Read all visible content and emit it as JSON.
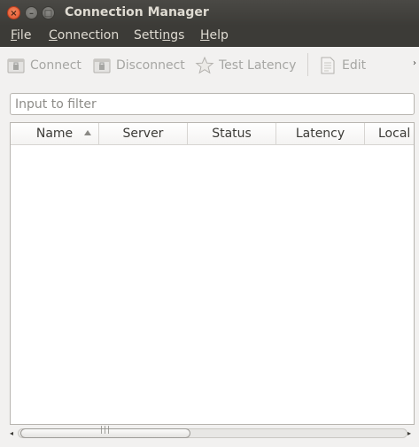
{
  "window": {
    "title": "Connection Manager",
    "close_glyph": "×",
    "minimize_glyph": "–",
    "maximize_glyph": "□"
  },
  "menu": {
    "file": {
      "mnemonic": "F",
      "rest": "ile"
    },
    "connection": {
      "mnemonic": "C",
      "rest": "onnection"
    },
    "settings": {
      "before": "Setti",
      "mnemonic": "n",
      "rest": "gs"
    },
    "help": {
      "mnemonic": "H",
      "rest": "elp"
    }
  },
  "toolbar": {
    "connect_label": "Connect",
    "disconnect_label": "Disconnect",
    "test_latency_label": "Test Latency",
    "edit_label": "Edit",
    "overflow_glyph": "›",
    "icons": {
      "connect": "connect-icon",
      "disconnect": "disconnect-icon",
      "test_latency": "star-icon",
      "edit": "document-icon"
    },
    "disabled_color": "#a6a6a3"
  },
  "filter": {
    "value": "",
    "placeholder": "Input to filter"
  },
  "table": {
    "columns": [
      "Name",
      "Server",
      "Status",
      "Latency",
      "Local"
    ],
    "sort_column": "Name",
    "sort_direction": "ascending",
    "rows": []
  },
  "scrollbar": {
    "left_arrow": "◂",
    "right_arrow": "▸",
    "grip": "|||"
  },
  "colors": {
    "titlebar": "#3c3b37",
    "close_button": "#e2502b",
    "window_bg": "#f2f1f0"
  }
}
